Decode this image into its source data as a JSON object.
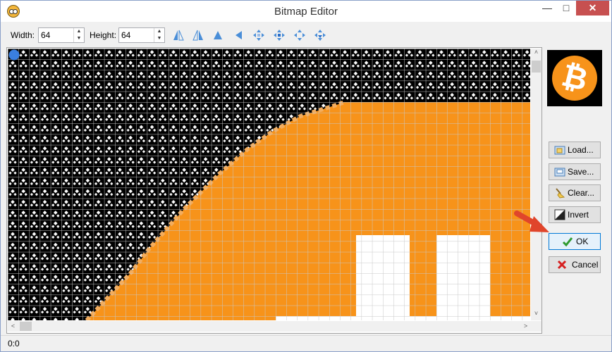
{
  "window": {
    "title": "Bitmap Editor"
  },
  "toolbar": {
    "width_label": "Width:",
    "width_value": "64",
    "height_label": "Height:",
    "height_value": "64",
    "tools": [
      "flip-horizontal-icon",
      "flip-vertical-icon",
      "mirror-icon",
      "shift-left-icon",
      "move-icon",
      "move-right-icon",
      "move-up-icon",
      "move-down-icon"
    ]
  },
  "side": {
    "load_label": "Load...",
    "save_label": "Save...",
    "clear_label": "Clear...",
    "invert_label": "Invert",
    "ok_label": "OK",
    "cancel_label": "Cancel"
  },
  "preview": {
    "symbol": "₿"
  },
  "status": {
    "text": "0:0"
  },
  "colors": {
    "orange": "#f7931a",
    "black": "#000000",
    "white": "#ffffff",
    "grid": "#c8c8c8",
    "selection": "#3a7fe0"
  }
}
